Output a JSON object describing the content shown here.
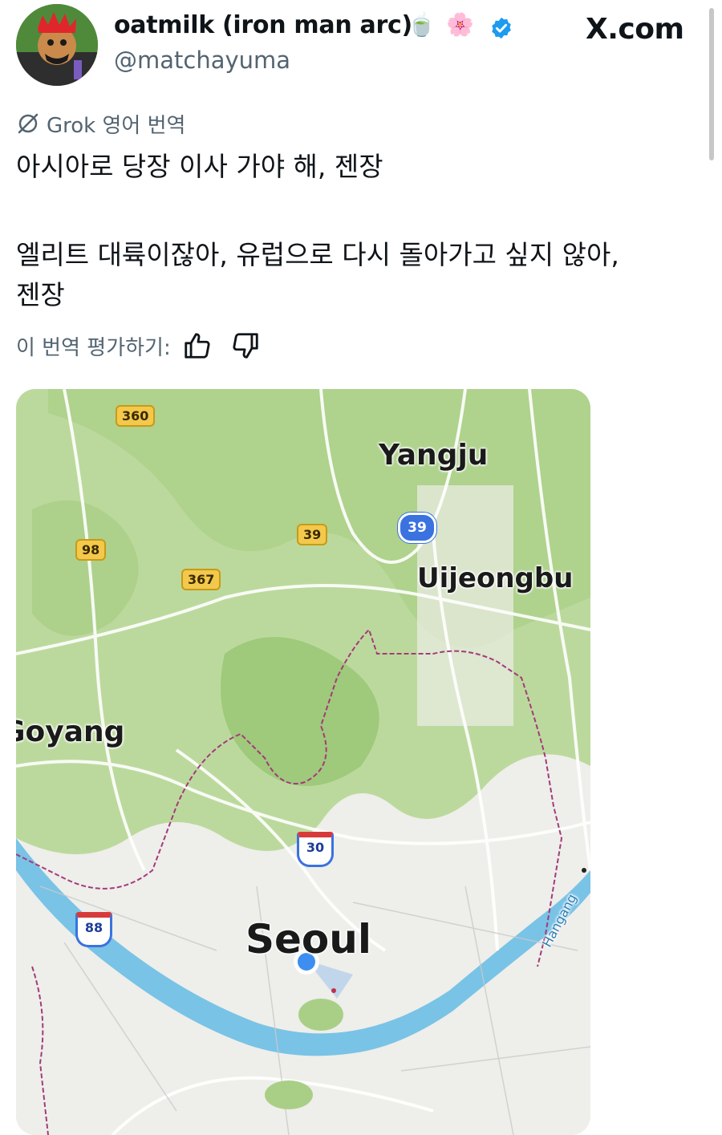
{
  "header": {
    "display_name": "oatmilk (iron man arc)",
    "emoji_1": "🍵",
    "emoji_2": "🌸",
    "handle": "@matchayuma",
    "site_label": "X.com"
  },
  "translation": {
    "label": "Grok 영어 번역",
    "line_1": "아시아로 당장 이사 가야 해, 젠장",
    "line_2": "엘리트 대륙이잖아, 유럽으로 다시 돌아가고 싶지 않아,",
    "line_3": "젠장",
    "rate_label": "이 번역 평가하기:"
  },
  "map": {
    "cities": {
      "yangju": "Yangju",
      "uijeongbu": "Uijeongbu",
      "goyang": "Goyang",
      "seoul": "Seoul",
      "hangang": "Hangang"
    },
    "routes": {
      "r360": "360",
      "r98": "98",
      "r39y": "39",
      "r367": "367",
      "r39b": "39",
      "r30": "30",
      "r88": "88"
    }
  },
  "colors": {
    "verified": "#1d9bf0",
    "handle_text": "#536471",
    "river": "#79c3e6",
    "forest": "#b9d89a",
    "location_dot": "#3d8ef0"
  }
}
